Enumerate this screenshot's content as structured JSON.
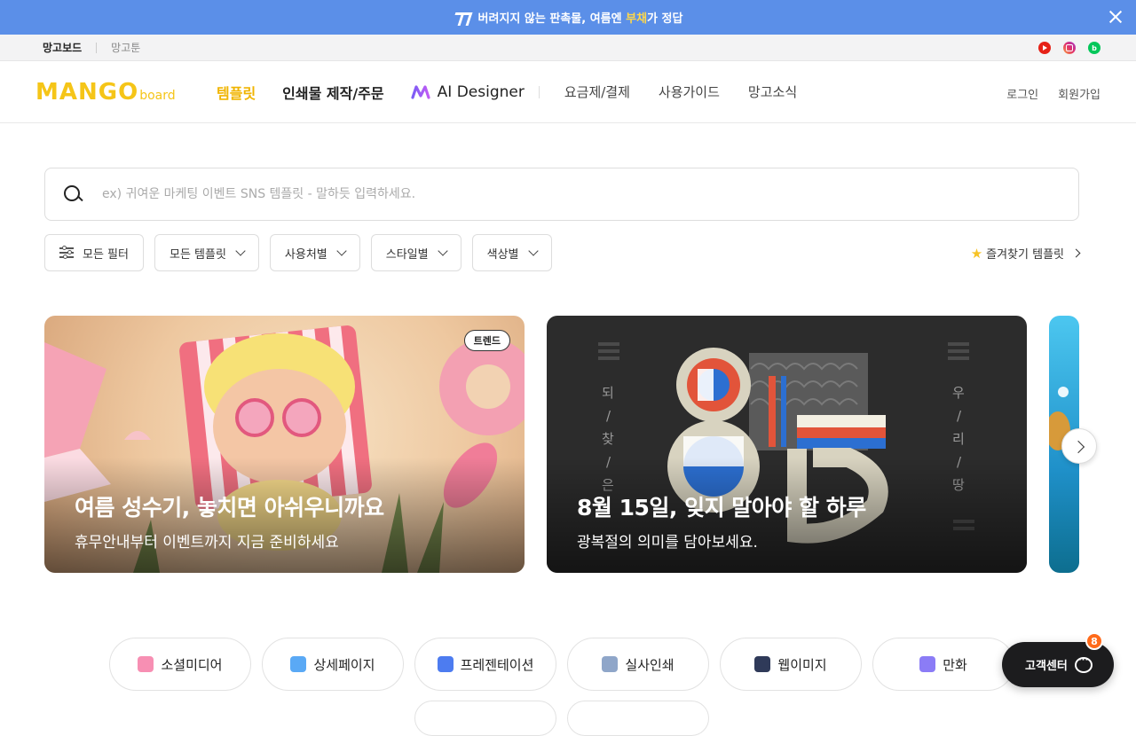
{
  "promo": {
    "text_before": "버려지지 않는 판촉물, 여름엔 ",
    "highlight": "부채",
    "text_after": "가 정답",
    "bg_color": "#5b8fe8",
    "highlight_color": "#ffd84a"
  },
  "subbar": {
    "services": [
      "망고보드",
      "망고툰"
    ],
    "social_icons": [
      "youtube-icon",
      "instagram-icon",
      "blog-icon"
    ]
  },
  "header": {
    "logo_main": "MANGO",
    "logo_sub": "board",
    "nav": [
      "템플릿",
      "인쇄물 제작/주문"
    ],
    "ai_label": "AI Designer",
    "subnav": [
      "요금제/결제",
      "사용가이드",
      "망고소식"
    ],
    "login": "로그인",
    "signup": "회원가입",
    "accent": "#f0b400"
  },
  "search": {
    "placeholder": "ex) 귀여운 마케팅 이벤트 SNS 템플릿 - 말하듯 입력하세요.",
    "value": ""
  },
  "filters": {
    "all_filter": "모든 필터",
    "dropdowns": [
      "모든 템플릿",
      "사용처별",
      "스타일별",
      "색상별"
    ],
    "favorites": "즐겨찾기 템플릿"
  },
  "banners": [
    {
      "title": "여름 성수기, 놓치면 아쉬우니까요",
      "desc": "휴무안내부터 이벤트까지 지금 준비하세요",
      "badge": "트렌드"
    },
    {
      "title": "8월 15일, 잊지 말아야 할 하루",
      "desc": "광복절의 의미를 담아보세요.",
      "side_left": "되/찾/은",
      "side_right": "우/리/땅"
    }
  ],
  "categories": [
    {
      "label": "소셜미디어",
      "color": "#f78fb3"
    },
    {
      "label": "상세페이지",
      "color": "#5aa9f5"
    },
    {
      "label": "프레젠테이션",
      "color": "#4d7cf0"
    },
    {
      "label": "실사인쇄",
      "color": "#8fa6c9"
    },
    {
      "label": "웹이미지",
      "color": "#2f3a59"
    },
    {
      "label": "만화",
      "color": "#8b7cf6"
    }
  ],
  "customer_center": {
    "label": "고객센터",
    "count": "8"
  }
}
